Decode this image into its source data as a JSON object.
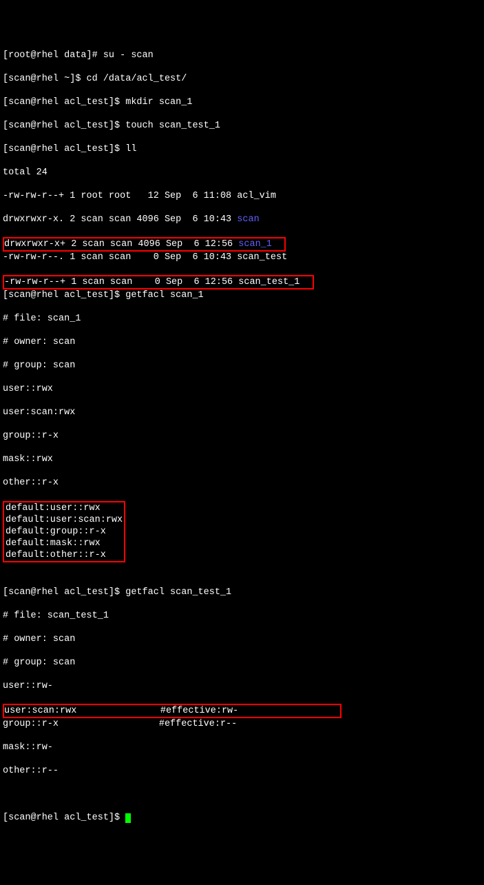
{
  "prompts": {
    "root_data": "[root@rhel data]# ",
    "scan_home": "[scan@rhel ~]$ ",
    "scan_acltest": "[scan@rhel acl_test]$ "
  },
  "cmds": {
    "su": "su - scan",
    "cd": "cd /data/acl_test/",
    "mkdir": "mkdir scan_1",
    "touch": "touch scan_test_1",
    "ll": "ll",
    "getfacl1": "getfacl scan_1",
    "getfacl2": "getfacl scan_test_1"
  },
  "ll_total": "total 24",
  "ll_rows": {
    "r0a": "-rw-rw-r--+ 1 root root   12 Sep  6 11:08 ",
    "r0b": "acl_vim",
    "r1a": "drwxrwxr-x. 2 scan scan 4096 Sep  6 10:43 ",
    "r1b": "scan",
    "r2a": "drwxrwxr-x+ 2 scan scan 4096 Sep  6 12:56 ",
    "r2b": "scan_1",
    "r3": "-rw-rw-r--. 1 scan scan    0 Sep  6 10:43 scan_test",
    "r4": "-rw-rw-r--+ 1 scan scan    0 Sep  6 12:56 scan_test_1"
  },
  "facl1": {
    "file": "# file: scan_1",
    "owner": "# owner: scan",
    "group": "# group: scan",
    "u": "user::rwx",
    "us": "user:scan:rwx",
    "g": "group::r-x",
    "m": "mask::rwx",
    "o": "other::r-x",
    "du": "default:user::rwx",
    "dus": "default:user:scan:rwx",
    "dg": "default:group::r-x",
    "dm": "default:mask::rwx",
    "do": "default:other::r-x"
  },
  "facl2": {
    "file": "# file: scan_test_1",
    "owner": "# owner: scan",
    "group": "# group: scan",
    "u": "user::rw-",
    "us": "user:scan:rwx               #effective:rw-",
    "g": "group::r-x                  #effective:r--",
    "m": "mask::rw-",
    "o": "other::r--"
  }
}
